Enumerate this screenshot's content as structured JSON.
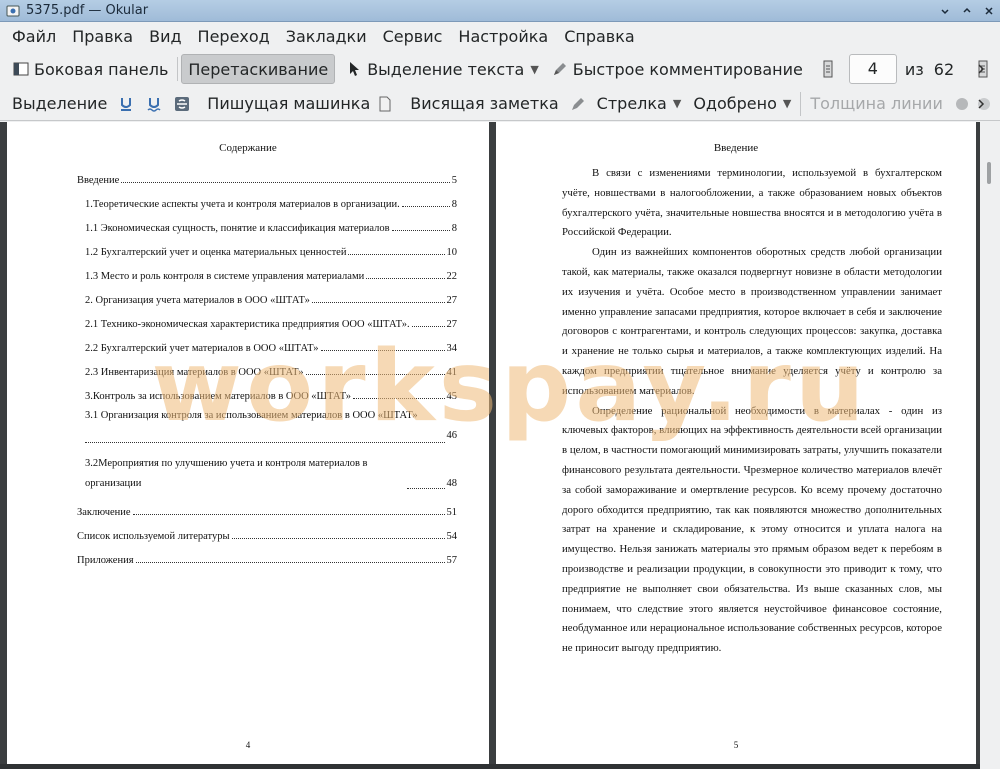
{
  "window": {
    "title": "5375.pdf — Okular"
  },
  "menu": [
    "Файл",
    "Правка",
    "Вид",
    "Переход",
    "Закладки",
    "Сервис",
    "Настройка",
    "Справка"
  ],
  "toolbar1": {
    "sidebar": "Боковая панель",
    "browse": "Перетаскивание",
    "text_select": "Выделение текста",
    "quick_annot": "Быстрое комментирование",
    "page_current": "4",
    "page_of": "из",
    "page_total": "62"
  },
  "toolbar2": {
    "highlight": "Выделение",
    "typewriter": "Пишущая машинка",
    "popup_note": "Висящая заметка",
    "arrow": "Стрелка",
    "approved": "Одобрено",
    "line_width": "Толщина линии"
  },
  "left_page": {
    "title": "Содержание",
    "number": "4",
    "toc": [
      {
        "text": "Введение",
        "page": "5"
      },
      {
        "text": "1.Теоретические аспекты учета и контроля материалов в организации.",
        "page": "8"
      },
      {
        "text": "1.1 Экономическая сущность, понятие и классификация материалов",
        "page": "8"
      },
      {
        "text": "1.2 Бухгалтерский учет и оценка материальных ценностей",
        "page": "10"
      },
      {
        "text": "1.3 Место и роль контроля в системе управления материалами",
        "page": "22"
      },
      {
        "text": "2. Организация учета материалов в ООО «ШТАТ»",
        "page": "27"
      },
      {
        "text": "2.1 Технико-экономическая характеристика предприятия ООО «ШТАТ».",
        "page": "27"
      },
      {
        "text": "2.2 Бухгалтерский учет материалов в ООО «ШТАТ»",
        "page": "34"
      },
      {
        "text": "2.3 Инвентаризация материалов в ООО «ШТАТ»",
        "page": "41"
      },
      {
        "text": "3.Контроль за использованием материалов в ООО «ШТАТ»",
        "page": "45"
      },
      {
        "text": "3.1 Организация контроля за использованием материалов в ООО «ШТАТ»",
        "page": "46"
      },
      {
        "text": "3.2Мероприятия по улучшению учета и контроля материалов в организации",
        "page": "48"
      },
      {
        "text": "Заключение",
        "page": "51"
      },
      {
        "text": "Список используемой литературы",
        "page": "54"
      },
      {
        "text": "Приложения",
        "page": "57"
      }
    ]
  },
  "right_page": {
    "title": "Введение",
    "number": "5",
    "paragraphs": [
      "В связи с изменениями терминологии, используемой в бухгалтерском учёте, новшествами в налогообложении, а также образованием новых объектов бухгалтерского учёта, значительные новшества вносятся и в методологию учёта в Российской Федерации.",
      "Один из важнейших компонентов оборотных средств любой организации такой, как материалы, также оказался подвергнут новизне в области методологии их изучения и учёта. Особое место в производственном управлении занимает именно управление запасами предприятия, которое включает в себя и заключение договоров с контрагентами, и контроль следующих процессов: закупка, доставка и хранение не только сырья и материалов, а также комплектующих изделий. На каждом предприятии тщательное внимание уделяется учёту и контролю за использованием материалов.",
      "Определение рациональной необходимости в материалах - один из ключевых факторов, влияющих на эффективность деятельности всей организации в целом, в частности помогающий минимизировать затраты, улучшить показатели финансового результата деятельности. Чрезмерное количество материалов влечёт за собой замораживание и омертвление ресурсов. Ко всему прочему достаточно дорого обходится предприятию, так как появляются множество дополнительных затрат на хранение и складирование, к этому относится и уплата налога на имущество. Нельзя занижать материалы это прямым образом ведет к перебоям в производстве и реализации продукции, в совокупности это приводит к тому, что предприятие не выполняет свои обязательства. Из выше сказанных слов, мы понимаем, что следствие этого является неустойчивое финансовое состояние, необдуманное или нерациональное использование собственных ресурсов, которое не приносит выгоду предприятию."
    ]
  },
  "watermark": "workspay.ru",
  "icons": {
    "sidebar": "sidebar-icon",
    "text_select": "cursor-icon",
    "quick_annot": "pen-icon",
    "highlight": "highlighter-icon",
    "underline": "underline-icon",
    "typewriter": "typewriter-icon",
    "popup_note": "note-icon",
    "arrow": "arrow-icon"
  }
}
